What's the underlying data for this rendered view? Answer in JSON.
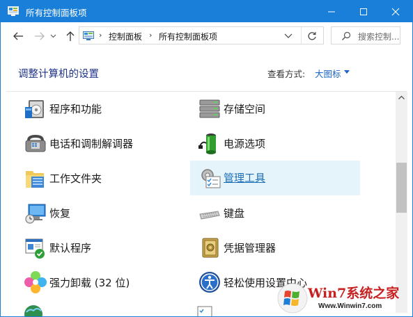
{
  "window": {
    "title": "所有控制面板项",
    "accent": "#1a7fd8"
  },
  "address": {
    "crumbs": [
      "控制面板",
      "所有控制面板项"
    ]
  },
  "search": {
    "placeholder": "搜索控制..."
  },
  "header": {
    "title": "调整计算机的设置",
    "view_label": "查看方式:",
    "view_value": "大图标"
  },
  "items": [
    {
      "label": "程序和功能",
      "icon": "programs-features-icon"
    },
    {
      "label": "存储空间",
      "icon": "storage-spaces-icon"
    },
    {
      "label": "电话和调制解调器",
      "icon": "phone-modem-icon"
    },
    {
      "label": "电源选项",
      "icon": "power-options-icon"
    },
    {
      "label": "工作文件夹",
      "icon": "work-folders-icon"
    },
    {
      "label": "管理工具",
      "icon": "admin-tools-icon"
    },
    {
      "label": "恢复",
      "icon": "recovery-icon"
    },
    {
      "label": "键盘",
      "icon": "keyboard-icon"
    },
    {
      "label": "默认程序",
      "icon": "default-programs-icon"
    },
    {
      "label": "凭据管理器",
      "icon": "credential-manager-icon"
    },
    {
      "label": "强力卸载 (32 位)",
      "icon": "uninstaller-icon"
    },
    {
      "label": "轻松使用设置中心",
      "icon": "ease-of-access-icon"
    }
  ],
  "watermark": {
    "title": "Win7系统之家",
    "url": "Www.Winwin7.com"
  }
}
